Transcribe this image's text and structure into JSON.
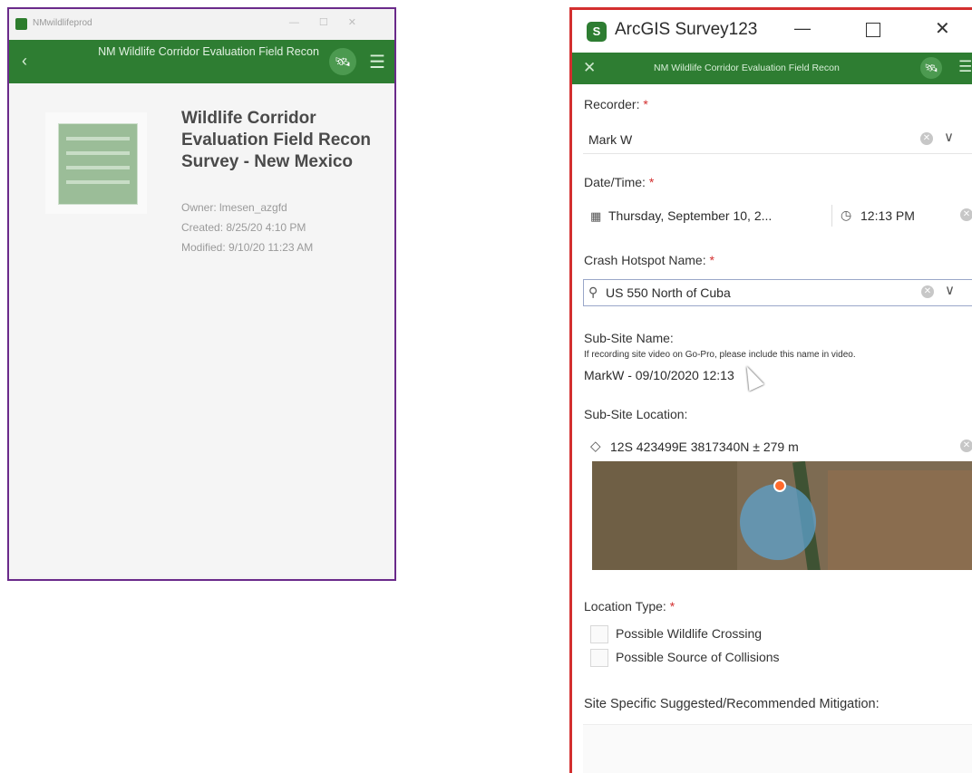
{
  "left_window": {
    "title_text": "NMwildlifeprod",
    "header_title": "NM Wildlife Corridor Evaluation Field Recon",
    "survey": {
      "title": "Wildlife Corridor Evaluation Field Recon Survey - New Mexico",
      "owner": "Owner: lmesen_azgfd",
      "created": "Created: 8/25/20 4:10 PM",
      "modified": "Modified: 9/10/20 11:23 AM"
    }
  },
  "right_window": {
    "app_title": "ArcGIS Survey123",
    "header_title": "NM Wildlife Corridor Evaluation Field Recon",
    "form": {
      "recorder": {
        "label": "Recorder:",
        "value": "Mark W"
      },
      "datetime": {
        "label": "Date/Time:",
        "date_value": "Thursday, September 10, 2...",
        "time_value": "12:13 PM"
      },
      "hotspot": {
        "label": "Crash Hotspot Name:",
        "value": "US 550 North of Cuba"
      },
      "subsite_name": {
        "label": "Sub-Site Name:",
        "hint": "If recording site video on Go-Pro, please include this name in video.",
        "value": "MarkW - 09/10/2020 12:13"
      },
      "subsite_location": {
        "label": "Sub-Site Location:",
        "value": "12S 423499E 3817340N ± 279 m"
      },
      "location_type": {
        "label": "Location Type:",
        "options": [
          "Possible Wildlife Crossing",
          "Possible Source of Collisions"
        ]
      },
      "mitigation": {
        "label": "Site Specific Suggested/Recommended Mitigation:"
      }
    }
  },
  "required_marker": "*"
}
